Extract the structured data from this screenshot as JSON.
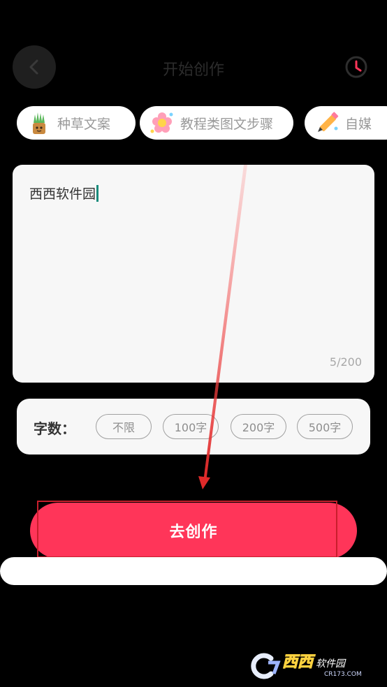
{
  "header": {
    "title": "开始创作",
    "back_icon": "chevron-left-icon",
    "history_icon": "clock-icon",
    "accent": "#ff3559"
  },
  "templates": [
    {
      "label": "种草文案",
      "icon": "potted-plant-icon"
    },
    {
      "label": "教程类图文步骤",
      "icon": "flower-icon"
    },
    {
      "label": "自媒",
      "icon": "pencil-icon"
    }
  ],
  "editor": {
    "value": "西西软件园",
    "counter": "5/200"
  },
  "word_count": {
    "label": "字数：",
    "options": [
      "不限",
      "100字",
      "200字",
      "500字"
    ]
  },
  "action": {
    "create_label": "去创作"
  },
  "watermark": {
    "brand": "西西",
    "name": "软件园",
    "domain": "CR173.COM"
  },
  "colors": {
    "background": "#000000",
    "card": "#f7f7f7",
    "primary_button": "#ff3559",
    "annotation": "#e02a2a"
  }
}
